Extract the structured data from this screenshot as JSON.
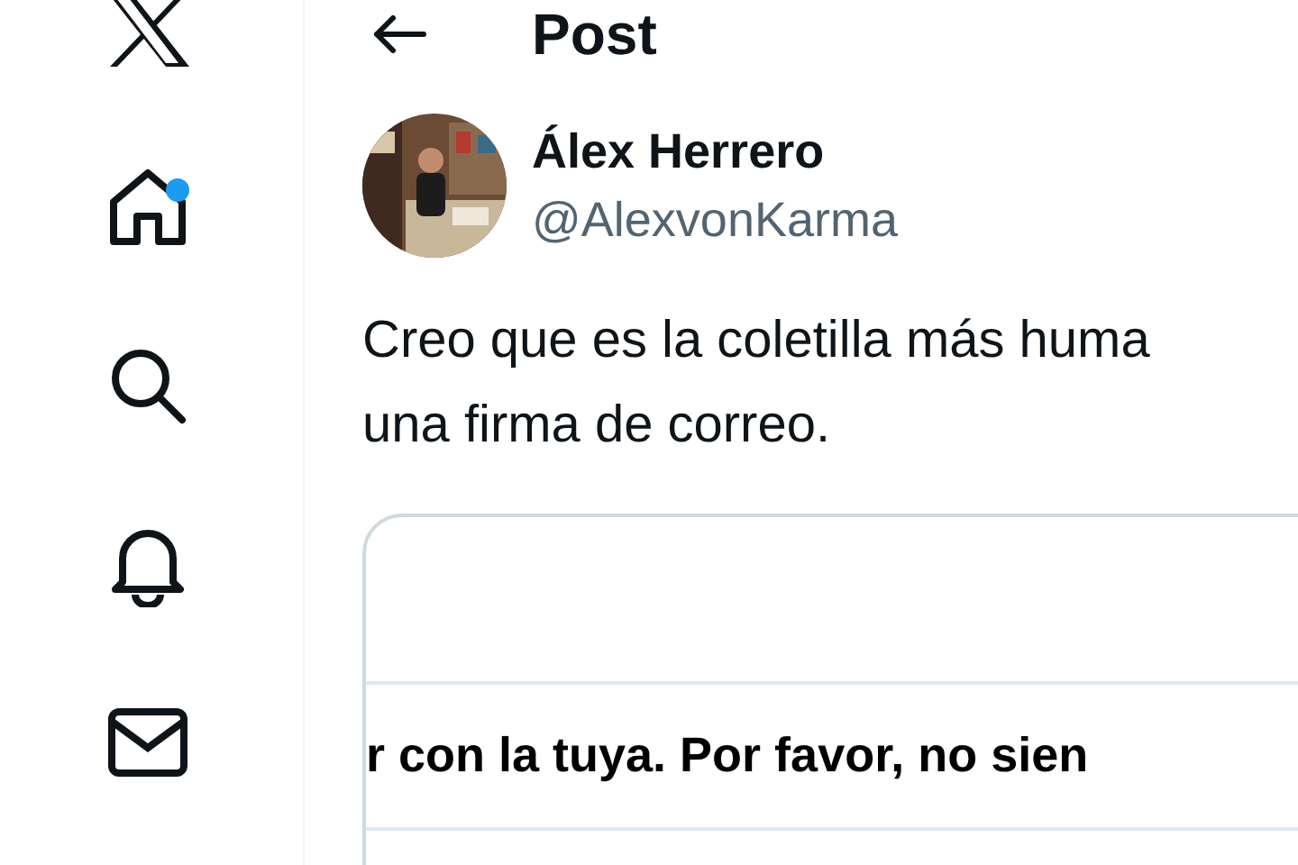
{
  "sidebar": {
    "items": [
      {
        "kind": "logo",
        "notification_dot": false
      },
      {
        "kind": "home",
        "notification_dot": true
      },
      {
        "kind": "search",
        "notification_dot": false
      },
      {
        "kind": "bell",
        "notification_dot": false
      },
      {
        "kind": "mail",
        "notification_dot": false
      }
    ]
  },
  "header": {
    "title": "Post"
  },
  "post": {
    "author": {
      "name": "Álex Herrero",
      "handle": "@AlexvonKarma"
    },
    "text_lines": [
      "Creo que es la coletilla más huma",
      "una firma de correo."
    ],
    "embed": {
      "line": "r con la tuya. Por favor, no sien"
    }
  }
}
